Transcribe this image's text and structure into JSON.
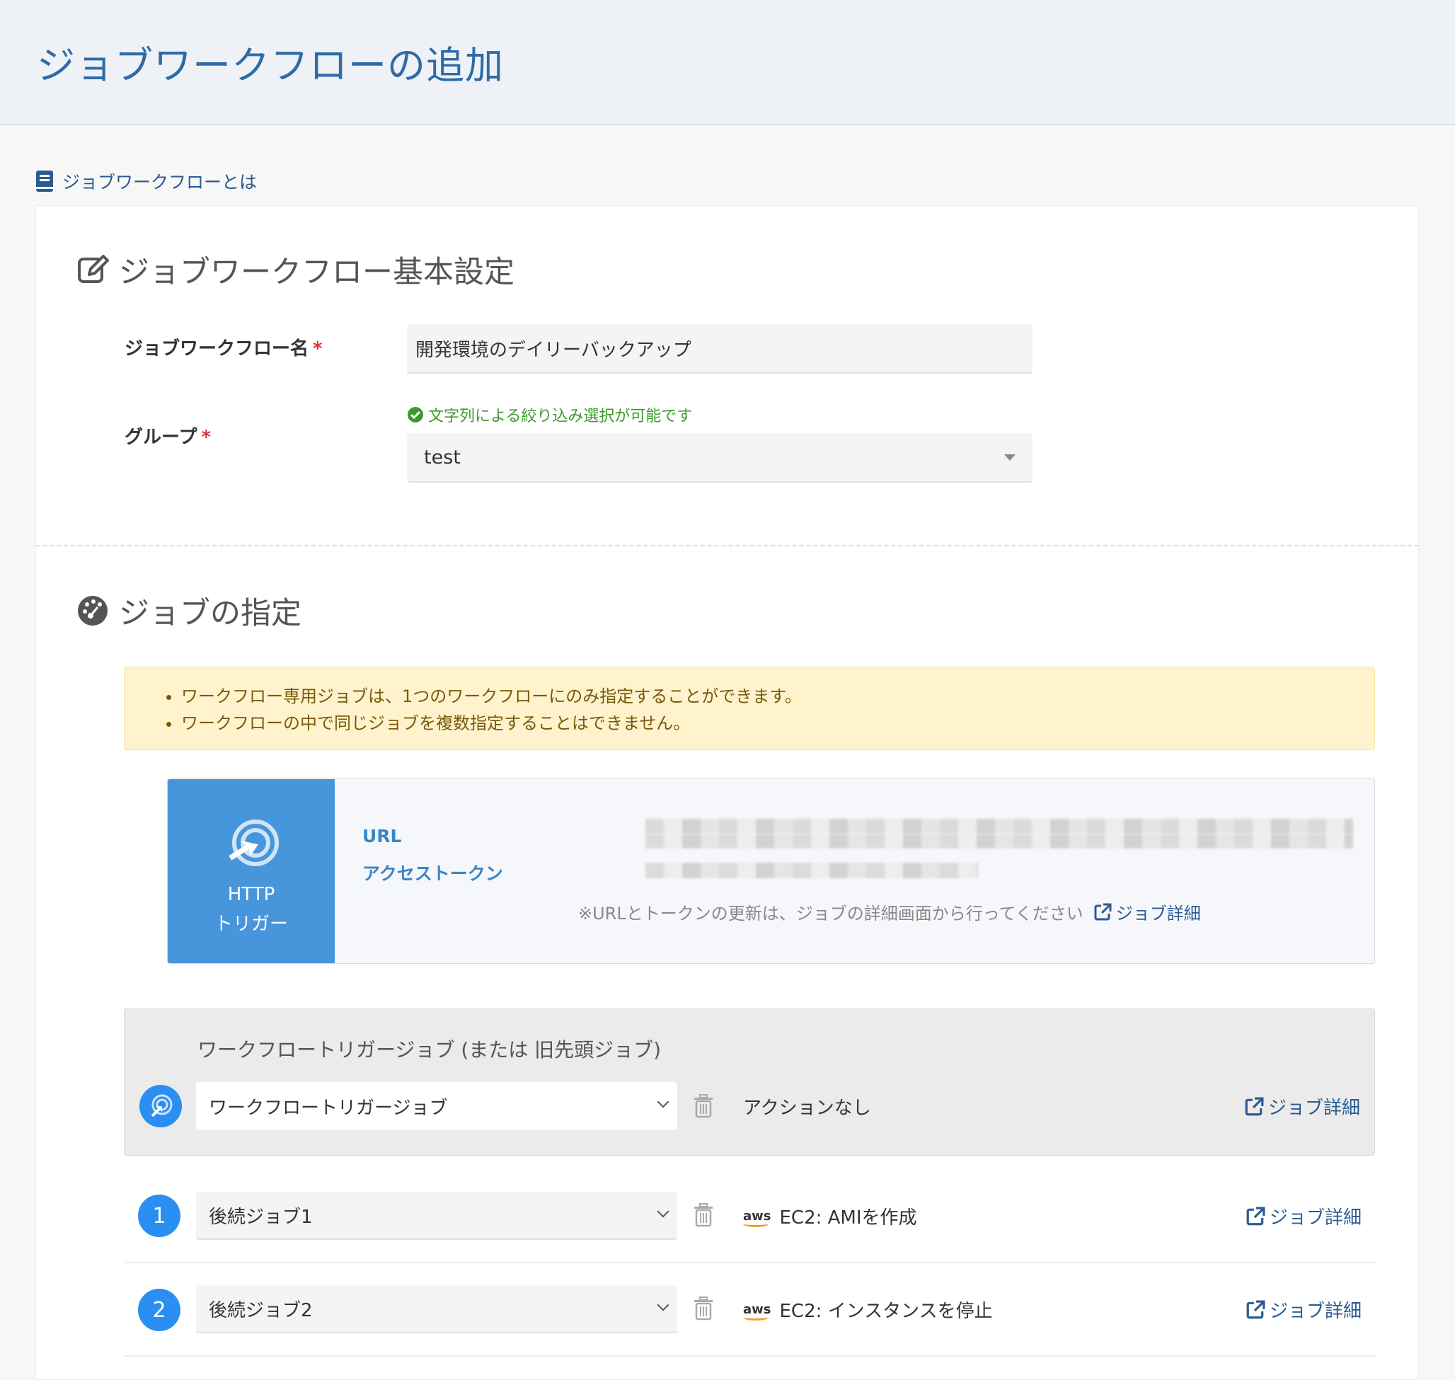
{
  "page": {
    "title": "ジョブワークフローの追加"
  },
  "help": {
    "label": "ジョブワークフローとは"
  },
  "basic": {
    "section_title": "ジョブワークフロー基本設定",
    "name_label": "ジョブワークフロー名",
    "name_value": "開発環境のデイリーバックアップ",
    "group_label": "グループ",
    "group_hint": "文字列による絞り込み選択が可能です",
    "group_value": "test",
    "required_mark": "*"
  },
  "jobs": {
    "section_title": "ジョブの指定",
    "notices": [
      "ワークフロー専用ジョブは、1つのワークフローにのみ指定することができます。",
      "ワークフローの中で同じジョブを複数指定することはできません。"
    ],
    "http": {
      "line1": "HTTP",
      "line2": "トリガー",
      "url_label": "URL",
      "token_label": "アクセストークン",
      "note": "※URLとトークンの更新は、ジョブの詳細画面から行ってください",
      "detail_link": "ジョブ詳細"
    },
    "trigger_panel": {
      "title": "ワークフロートリガージョブ (または 旧先頭ジョブ)",
      "select_value": "ワークフロートリガージョブ",
      "action": "アクションなし",
      "detail_link": "ジョブ詳細"
    },
    "followers": [
      {
        "number": "1",
        "select_value": "後続ジョブ1",
        "aws": "aws",
        "action": "EC2: AMIを作成",
        "detail_link": "ジョブ詳細"
      },
      {
        "number": "2",
        "select_value": "後続ジョブ2",
        "aws": "aws",
        "action": "EC2: インスタンスを停止",
        "detail_link": "ジョブ詳細"
      }
    ]
  },
  "colors": {
    "accent": "#2f6ba6",
    "http_blue": "#4796dc",
    "step_blue": "#2a8ff0",
    "notice_bg": "#fff3cd",
    "hint_green": "#3c9a2c"
  }
}
